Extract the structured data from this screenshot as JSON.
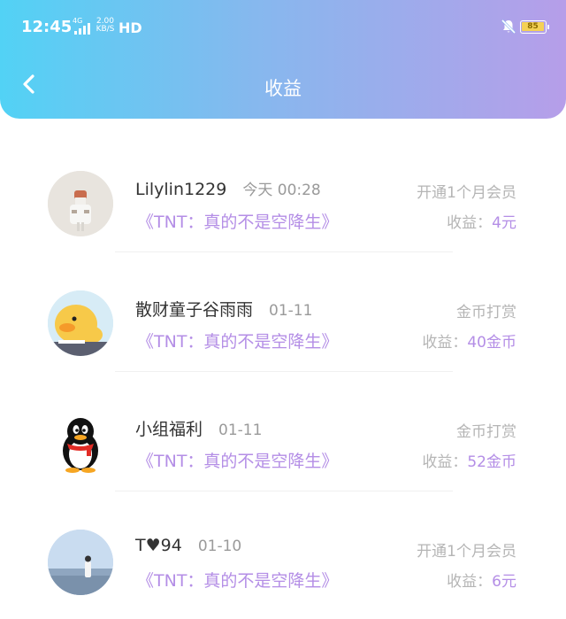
{
  "status_bar": {
    "time": "12:45",
    "network": "4G",
    "speed_value": "2.00",
    "speed_unit": "KB/S",
    "hd": "HD",
    "battery": "85"
  },
  "nav": {
    "title": "收益"
  },
  "records": [
    {
      "name": "Lilylin1229",
      "time": "今天 00:28",
      "book": "《TNT：真的不是空降生》",
      "type": "开通1个月会员",
      "income_label": "收益：",
      "income_amount": "4元"
    },
    {
      "name": "散财童子谷雨雨",
      "time": "01-11",
      "book": "《TNT：真的不是空降生》",
      "type": "金币打赏",
      "income_label": "收益：",
      "income_amount": "40金币"
    },
    {
      "name": "小组福利",
      "time": "01-11",
      "book": "《TNT：真的不是空降生》",
      "type": "金币打赏",
      "income_label": "收益：",
      "income_amount": "52金币"
    },
    {
      "name": "T♥94",
      "time": "01-10",
      "book": "《TNT：真的不是空降生》",
      "type": "开通1个月会员",
      "income_label": "收益：",
      "income_amount": "6元"
    }
  ],
  "colors": {
    "header_start": "#52d2f5",
    "header_end": "#b69ee9",
    "accent": "#b48ee6"
  },
  "icons": [
    "back-arrow-icon",
    "mute-icon",
    "battery-icon",
    "signal-icon"
  ]
}
